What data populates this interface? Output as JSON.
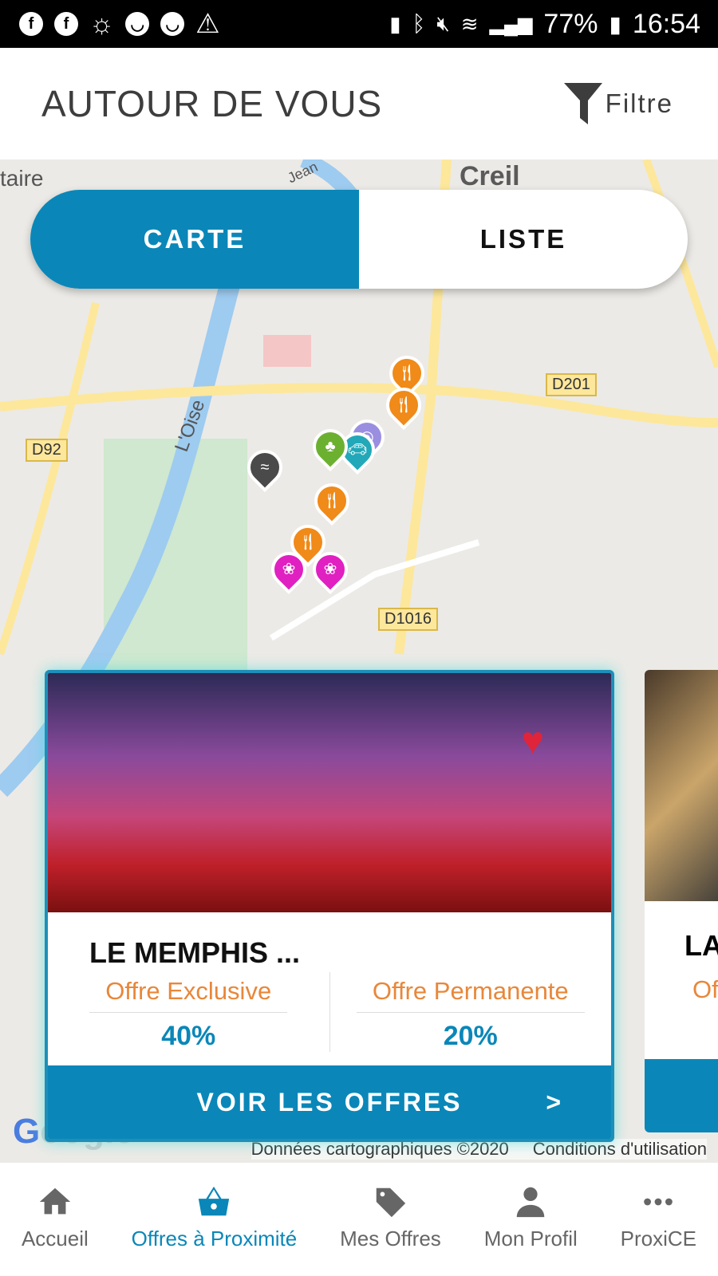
{
  "status_bar": {
    "battery": "77%",
    "time": "16:54",
    "left_icons": [
      "facebook-icon",
      "facebook-icon",
      "weather-icon",
      "app-icon",
      "app-icon",
      "warning-icon"
    ],
    "right_icons": [
      "battery-saver-icon",
      "bluetooth-icon",
      "mute-icon",
      "wifi-icon",
      "signal-icon",
      "battery-icon"
    ]
  },
  "header": {
    "title": "AUTOUR DE VOUS",
    "filter_label": "Filtre"
  },
  "toggle": {
    "map": "CARTE",
    "list": "LISTE",
    "selected": "CARTE"
  },
  "map": {
    "labels": {
      "city": "Creil",
      "left": "taire",
      "river": "L'Oise",
      "street": "Jean"
    },
    "roads": [
      "D201",
      "D92",
      "D1016"
    ],
    "attribution": "Données cartographiques ©2020",
    "terms": "Conditions d'utilisation",
    "google": "Google"
  },
  "cards": [
    {
      "title": "LE MEMPHIS ...",
      "offers": [
        {
          "label": "Offre Exclusive",
          "value": "40%"
        },
        {
          "label": "Offre Permanente",
          "value": "20%"
        }
      ],
      "cta": "VOIR LES OFFRES",
      "cta_arrow": ">",
      "favorite": true
    },
    {
      "title": "LA",
      "offer": "Of"
    }
  ],
  "nav": [
    {
      "label": "Accueil",
      "icon": "home-icon"
    },
    {
      "label": "Offres à Proximité",
      "icon": "basket-icon",
      "active": true
    },
    {
      "label": "Mes Offres",
      "icon": "tag-icon"
    },
    {
      "label": "Mon Profil",
      "icon": "person-icon"
    },
    {
      "label": "ProxiCE",
      "icon": "more-icon"
    }
  ],
  "colors": {
    "accent": "#0a87b8",
    "offer_label": "#e8873a"
  }
}
